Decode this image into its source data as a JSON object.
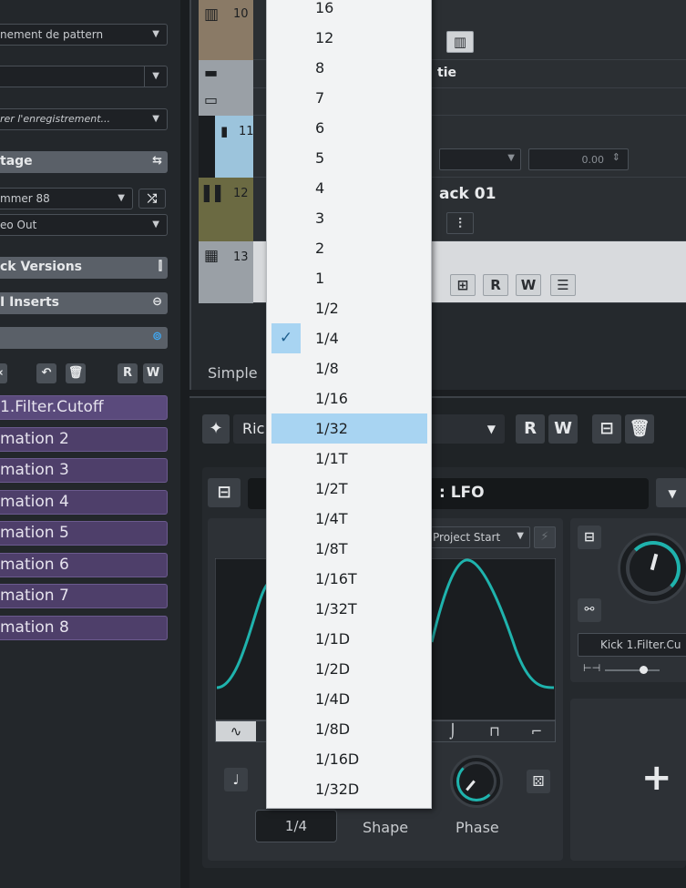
{
  "inspector": {
    "pattern_dropdown": "nement de pattern",
    "empty_dropdown": "",
    "record_dropdown": "rer l'enregistrement...",
    "section_tage": "tage",
    "instrument_dropdown": "mmer 88",
    "output_dropdown": "eo Out",
    "section_track_versions": "ck Versions",
    "section_inserts": "I Inserts",
    "section_blank": "",
    "rw_read": "R",
    "rw_write": "W",
    "lanes": [
      "1.Filter.Cutoff",
      "mation 2",
      "mation 3",
      "mation 4",
      "mation 5",
      "mation 6",
      "mation 7",
      "mation 8"
    ]
  },
  "tracks": [
    {
      "num": "10",
      "name": ""
    },
    {
      "num": "",
      "name": "tie"
    },
    {
      "num": "11",
      "name": ""
    },
    {
      "num": "12",
      "name": "ack 01"
    },
    {
      "num": "13",
      "name": ""
    }
  ],
  "track_area": {
    "value_field": "0.00",
    "btn_r": "R",
    "btn_w": "W",
    "simple_label": "Simple"
  },
  "modulator": {
    "preset_name": "Ric",
    "btn_r": "R",
    "btn_w": "W",
    "lfo_title": ": LFO",
    "trigger_mode": "Project Start",
    "target_name": "Kick 1.Filter.Cu",
    "rate_value": "1/4",
    "shape_label": "Shape",
    "phase_label": "Phase",
    "add_symbol": "+"
  },
  "menu": {
    "items": [
      "16",
      "12",
      "8",
      "7",
      "6",
      "5",
      "4",
      "3",
      "2",
      "1",
      "1/2",
      "1/4",
      "1/8",
      "1/16",
      "1/32",
      "1/1T",
      "1/2T",
      "1/4T",
      "1/8T",
      "1/16T",
      "1/32T",
      "1/1D",
      "1/2D",
      "1/4D",
      "1/8D",
      "1/16D",
      "1/32D"
    ],
    "checked": "1/4",
    "highlighted": "1/32"
  },
  "colors": {
    "accent_teal": "#1fb3ad",
    "lane_purple": "#4e3f6a",
    "menu_highlight": "#a8d4f2"
  }
}
